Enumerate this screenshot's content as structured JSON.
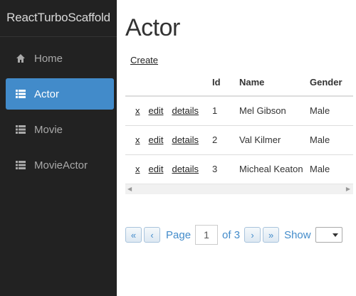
{
  "app": {
    "brand": "ReactTurboScaffold"
  },
  "sidebar": {
    "items": [
      {
        "label": "Home",
        "icon": "home-icon",
        "active": false
      },
      {
        "label": "Actor",
        "icon": "list-icon",
        "active": true
      },
      {
        "label": "Movie",
        "icon": "list-icon",
        "active": false
      },
      {
        "label": "MovieActor",
        "icon": "list-icon",
        "active": false
      }
    ]
  },
  "main": {
    "title": "Actor",
    "create_label": "Create",
    "table": {
      "headers": [
        "",
        "Id",
        "Name",
        "Gender"
      ],
      "rows": [
        {
          "delete": "x",
          "edit": "edit",
          "details": "details",
          "id": "1",
          "name": "Mel Gibson",
          "gender": "Male"
        },
        {
          "delete": "x",
          "edit": "edit",
          "details": "details",
          "id": "2",
          "name": "Val Kilmer",
          "gender": "Male"
        },
        {
          "delete": "x",
          "edit": "edit",
          "details": "details",
          "id": "3",
          "name": "Micheal Keaton",
          "gender": "Male"
        }
      ]
    },
    "pager": {
      "first": "«",
      "prev": "‹",
      "page_label": "Page",
      "current_page": "1",
      "of_label": "of 3",
      "next": "›",
      "last": "»",
      "show_label": "Show",
      "show_value": ""
    }
  },
  "colors": {
    "sidebar_bg": "#222222",
    "active": "#428bca",
    "link_blue": "#428bca"
  }
}
